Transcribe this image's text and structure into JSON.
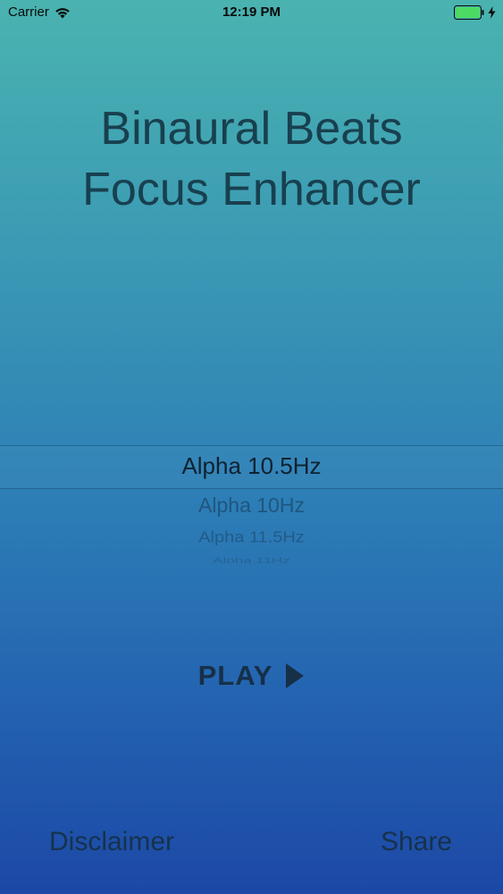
{
  "status_bar": {
    "carrier": "Carrier",
    "time": "12:19 PM",
    "battery_color": "#4cd964"
  },
  "title": {
    "line1": "Binaural Beats",
    "line2": "Focus Enhancer"
  },
  "picker": {
    "selected": "Alpha 10.5Hz",
    "options_below": [
      "Alpha 10Hz",
      "Alpha 11.5Hz",
      "Alpha 11Hz"
    ]
  },
  "play": {
    "label": "PLAY",
    "icon": "play-triangle-icon"
  },
  "footer": {
    "disclaimer_label": "Disclaimer",
    "share_label": "Share"
  },
  "colors": {
    "gradient_top": "#4ab3b0",
    "gradient_bottom": "#1c48a6",
    "text_dark": "#18404f"
  }
}
